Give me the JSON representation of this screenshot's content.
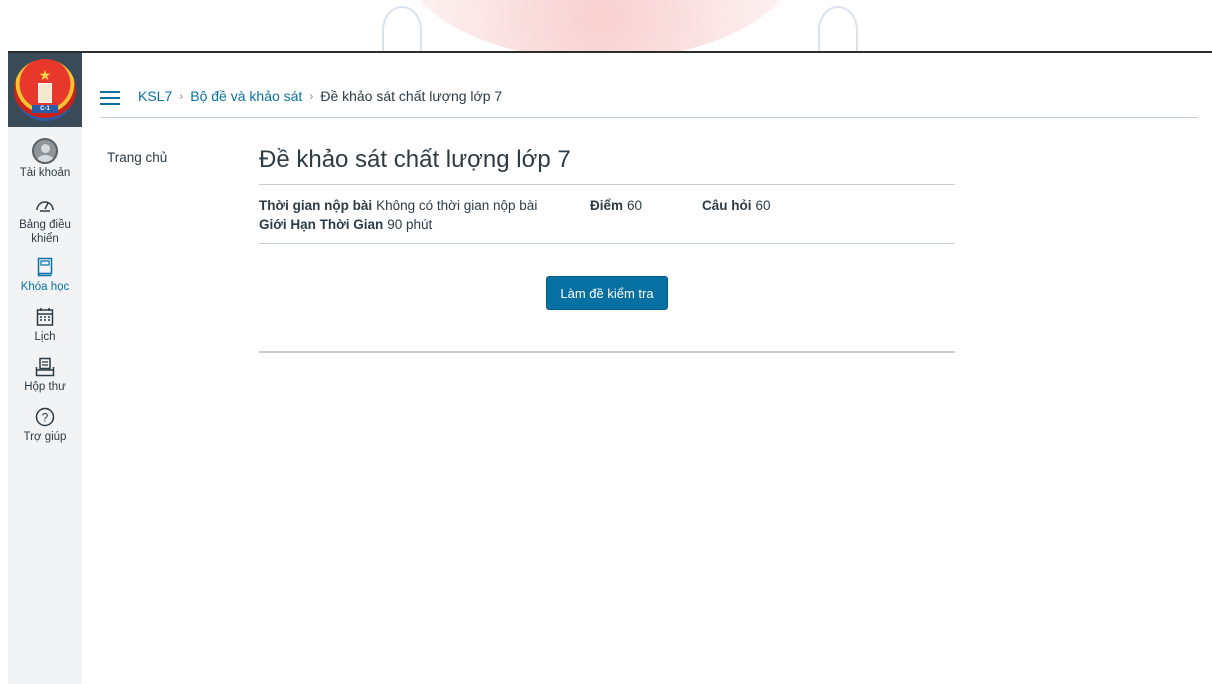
{
  "global_nav": {
    "items": [
      {
        "label": "Tài khoản",
        "icon": "user-avatar-icon"
      },
      {
        "label": "Bảng điều khiển",
        "icon": "dashboard-icon"
      },
      {
        "label": "Khóa học",
        "icon": "courses-icon",
        "active": true
      },
      {
        "label": "Lịch",
        "icon": "calendar-icon"
      },
      {
        "label": "Hộp thư",
        "icon": "inbox-icon"
      },
      {
        "label": "Trợ giúp",
        "icon": "help-icon"
      }
    ]
  },
  "header": {
    "breadcrumb": [
      "KSL7",
      "Bộ đề và khảo sát",
      "Đề khảo sát chất lượng lớp 7"
    ]
  },
  "course_nav": {
    "home": "Trang chủ"
  },
  "quiz": {
    "title": "Đề khảo sát chất lượng lớp 7",
    "due_label": "Thời gian nộp bài",
    "due_value": "Không có thời gian nộp bài",
    "points_label": "Điểm",
    "points_value": "60",
    "questions_label": "Câu hỏi",
    "questions_value": "60",
    "time_limit_label": "Giới Hạn Thời Gian",
    "time_limit_value": "90 phút",
    "take_button": "Làm đề kiểm tra"
  },
  "colors": {
    "accent": "#0770a3",
    "nav_bg": "#f2f3f4",
    "logo_bg": "#394b58"
  }
}
